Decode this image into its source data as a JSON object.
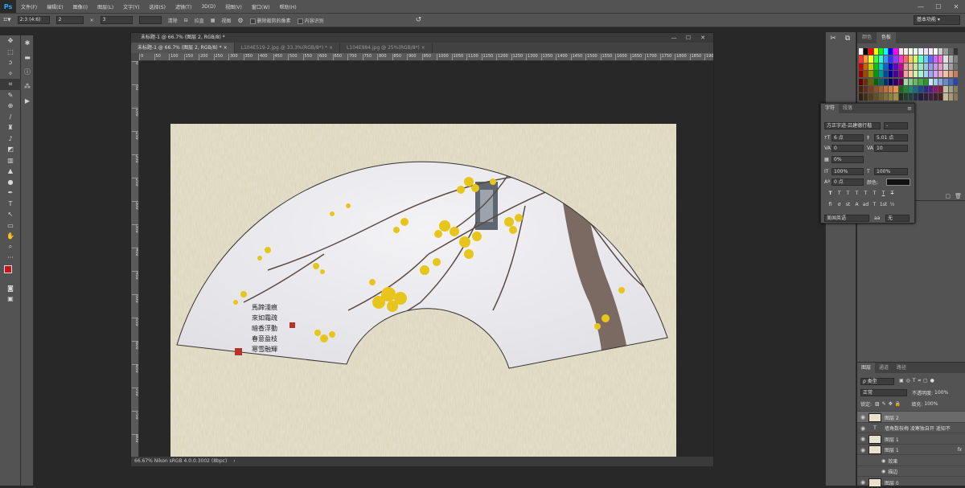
{
  "menubar": {
    "logo": "Ps",
    "items": [
      "文件(F)",
      "编辑(E)",
      "图像(I)",
      "图层(L)",
      "文字(Y)",
      "选择(S)",
      "滤镜(T)",
      "3D(D)",
      "视图(V)",
      "窗口(W)",
      "帮助(H)"
    ]
  },
  "options": {
    "ratio": "2:3 (4:6)",
    "width": "2",
    "sep": "×",
    "height": "3",
    "resolution": "",
    "clear": "清除",
    "straighten": "拉直",
    "overlay": "视图",
    "delete_pixels": "删除裁剪的像素",
    "content_aware": "内容识别",
    "reset": "↺"
  },
  "workspace": "基本功能",
  "document": {
    "title": "未标题-1 @ 66.7% (图层 2, RGB/8) *",
    "tabs": [
      {
        "label": "未标题-1 @ 66.7% (图层 2, RGB/8) *",
        "close": "×"
      },
      {
        "label": "L104E519-2.jpg @ 33.3%(RGB/8*) *",
        "close": "×"
      },
      {
        "label": "L104E984.jpg @ 25%(RGB/8*)",
        "close": "×"
      }
    ],
    "status": "66.67%   Nikon sRGB 4.0.0.3002 (8bpc)"
  },
  "ruler_h": [
    "0",
    "50",
    "100",
    "150",
    "200",
    "250",
    "300",
    "350",
    "400",
    "450",
    "500",
    "550",
    "600",
    "650",
    "700",
    "750",
    "800",
    "850",
    "900",
    "950",
    "1000",
    "1050",
    "1100",
    "1150",
    "1200",
    "1250",
    "1300",
    "1350",
    "1400",
    "1450",
    "1500",
    "1550",
    "1600",
    "1650",
    "1700",
    "1750",
    "1800",
    "1850",
    "1900"
  ],
  "ruler_v": [
    "0",
    "50",
    "100",
    "150",
    "200",
    "250",
    "300",
    "350",
    "400",
    "450",
    "500",
    "550",
    "600",
    "650",
    "700",
    "750",
    "800"
  ],
  "poem": {
    "columns": [
      "馬蹄淺痕",
      "來如霜疏",
      "暗香浮動",
      "春意盈枝",
      "寒雪融輝"
    ]
  },
  "colors": {
    "foreground": "#c4161c",
    "background": "#000000",
    "paper": "#ddd6bc",
    "fan": "#eaeaee",
    "flower": "#e7c51a",
    "seal": "#b8322a"
  },
  "swatch_panel": {
    "tabs": [
      "颜色",
      "色板"
    ],
    "colors": [
      "#ffffff",
      "#000000",
      "#ff0000",
      "#ffff00",
      "#00ff00",
      "#00ffff",
      "#0000ff",
      "#ff00ff",
      "#f8e6e6",
      "#f8f0e6",
      "#f0f8e6",
      "#e6f8ee",
      "#e6f0f8",
      "#ece6f8",
      "#f8e6f2",
      "#ffffff",
      "#cccccc",
      "#999999",
      "#666666",
      "#333333",
      "#ff3333",
      "#ff9933",
      "#ffff33",
      "#33ff33",
      "#33ffcc",
      "#3399ff",
      "#3333ff",
      "#9933ff",
      "#ff33cc",
      "#ff6666",
      "#ffcc66",
      "#ccff66",
      "#66ffcc",
      "#66ccff",
      "#6666ff",
      "#cc66ff",
      "#ff66cc",
      "#e0e0e0",
      "#b0b0b0",
      "#808080",
      "#cc0000",
      "#cc6600",
      "#cccc00",
      "#00cc00",
      "#00cccc",
      "#0066cc",
      "#0000cc",
      "#6600cc",
      "#cc0099",
      "#e69999",
      "#e6c299",
      "#c2e699",
      "#99e6c2",
      "#99c2e6",
      "#9999e6",
      "#c299e6",
      "#e699c2",
      "#d0d0d0",
      "#a0a0a0",
      "#707070",
      "#990000",
      "#994c00",
      "#999900",
      "#009900",
      "#009999",
      "#004c99",
      "#000099",
      "#4c0099",
      "#990073",
      "#f4a3a3",
      "#f4d0a3",
      "#d0f4a3",
      "#a3f4d0",
      "#a3d0f4",
      "#a3a3f4",
      "#d0a3f4",
      "#f4a3d0",
      "#f0c0a0",
      "#e0a080",
      "#c08060",
      "#660000",
      "#663300",
      "#666600",
      "#006600",
      "#006666",
      "#003366",
      "#000066",
      "#330066",
      "#66004c",
      "#a8d8a8",
      "#88c888",
      "#68b868",
      "#48a848",
      "#289828",
      "#c8e8f8",
      "#a8c8e8",
      "#88a8d8",
      "#6888c8",
      "#4868b8",
      "#2848a8",
      "#4a2010",
      "#603018",
      "#784020",
      "#905028",
      "#a86030",
      "#c07038",
      "#d88040",
      "#f09048",
      "#1a6a1a",
      "#1a8a3a",
      "#1a8a6a",
      "#1a6a8a",
      "#1a4a8a",
      "#2a2a8a",
      "#5a1a8a",
      "#8a1a6a",
      "#8a1a3a",
      "#c0c0a0",
      "#a0a080",
      "#808060",
      "#302010",
      "#403018",
      "#504020",
      "#605028",
      "#706030",
      "#807038",
      "#908040",
      "#a09048",
      "#203020",
      "#204030",
      "#204040",
      "#203040",
      "#202040",
      "#302040",
      "#402040",
      "#402030",
      "#402020",
      "#c8b898",
      "#a89878",
      "#887858"
    ]
  },
  "char_panel": {
    "tabs": [
      "字符",
      "段落"
    ],
    "font_family": "方正字迹-吕建德行楷",
    "font_style": "-",
    "size": "6 点",
    "leading": "5.01 点",
    "kerning": "0",
    "tracking": "10",
    "scale_pct": "0%",
    "vscale": "100%",
    "hscale": "100%",
    "baseline": "0 点",
    "color_label": "颜色:",
    "formats": [
      "T",
      "T",
      "T",
      "T",
      "T",
      "T",
      "T",
      "T"
    ],
    "ot_features": [
      "fi",
      "ơ",
      "st",
      "A",
      "ad",
      "T",
      "1st",
      "½"
    ],
    "language": "美国英语",
    "aa_icon": "aa",
    "aa": "无"
  },
  "layers_panel": {
    "tabs": [
      "图层",
      "通道",
      "路径"
    ],
    "filter": "ρ 类型",
    "blend": "正常",
    "opacity_label": "不透明度:",
    "opacity": "100%",
    "lock_label": "锁定:",
    "fill_label": "填充:",
    "fill": "100%",
    "layers": [
      {
        "name": "图层 2",
        "kind": "pixel",
        "selected": true
      },
      {
        "name": "墙角数枝梅   凌寒独自开   遥知不",
        "kind": "text",
        "selected": false
      },
      {
        "name": "图层 1",
        "kind": "pixel",
        "selected": false
      },
      {
        "name": "图层 1",
        "kind": "pixel-fx",
        "selected": false,
        "fx": "fx"
      },
      {
        "name": "效果",
        "kind": "effect",
        "selected": false
      },
      {
        "name": "描边",
        "kind": "effect",
        "selected": false
      },
      {
        "name": "图层 0",
        "kind": "pixel",
        "selected": false
      }
    ]
  }
}
